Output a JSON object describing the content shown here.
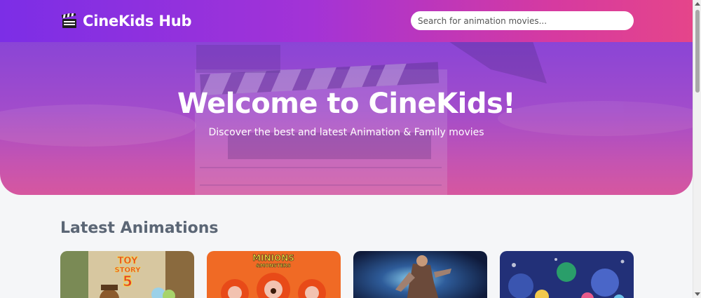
{
  "header": {
    "app_title": "CineKids Hub",
    "logo_icon": "clapperboard-icon",
    "search_placeholder": "Search for animation movies..."
  },
  "hero": {
    "title": "Welcome to CineKids!",
    "subtitle": "Discover the best and latest Animation & Family movies"
  },
  "section": {
    "title": "Latest Animations"
  },
  "movies": [
    {
      "poster_text": [
        "TOY",
        "STORY",
        "5"
      ],
      "accent": "#e8c23a"
    },
    {
      "poster_text": [
        "MINIONS",
        "&MONSTERS"
      ],
      "accent": "#f05a1e"
    },
    {
      "poster_text": [],
      "accent": "#2b3d78"
    },
    {
      "poster_text": [],
      "accent": "#2a3a8e"
    }
  ],
  "colors": {
    "header_start": "#7c2ee6",
    "header_end": "#e5458a",
    "section_title": "#5b6675"
  }
}
